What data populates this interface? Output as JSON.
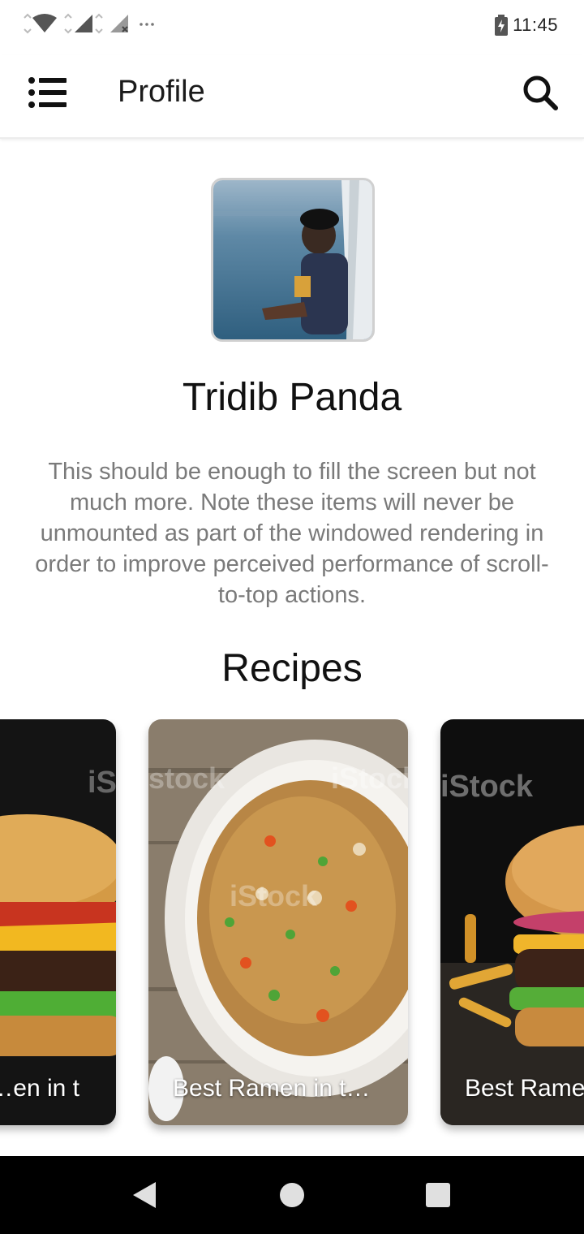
{
  "status_bar": {
    "time": "11:45",
    "icons": [
      "wifi-icon",
      "signal-icon",
      "signal-off-icon",
      "more-icon",
      "battery-charging-icon"
    ]
  },
  "app_bar": {
    "title": "Profile",
    "menu_icon": "list-icon",
    "search_icon": "search-icon"
  },
  "profile": {
    "name": "Tridib Panda",
    "bio": "This should be enough to fill the screen but not much more. Note these items will never be unmounted as part of the windowed rendering in order to improve perceived performance of scroll-to-top actions."
  },
  "recipes": {
    "title": "Recipes",
    "cards": [
      {
        "label": "Best Ramen in t…",
        "image": "burger",
        "visible_label": "en in t…"
      },
      {
        "label": "Best Ramen in t…",
        "image": "fried-rice"
      },
      {
        "label": "Best Rame",
        "image": "burger"
      }
    ],
    "watermark": "iStock"
  },
  "nav_bar": {
    "buttons": [
      "back-icon",
      "home-icon",
      "recents-icon"
    ]
  },
  "colors": {
    "text_primary": "#111111",
    "text_secondary": "#7a7a7a",
    "nav_bg": "#000000"
  }
}
